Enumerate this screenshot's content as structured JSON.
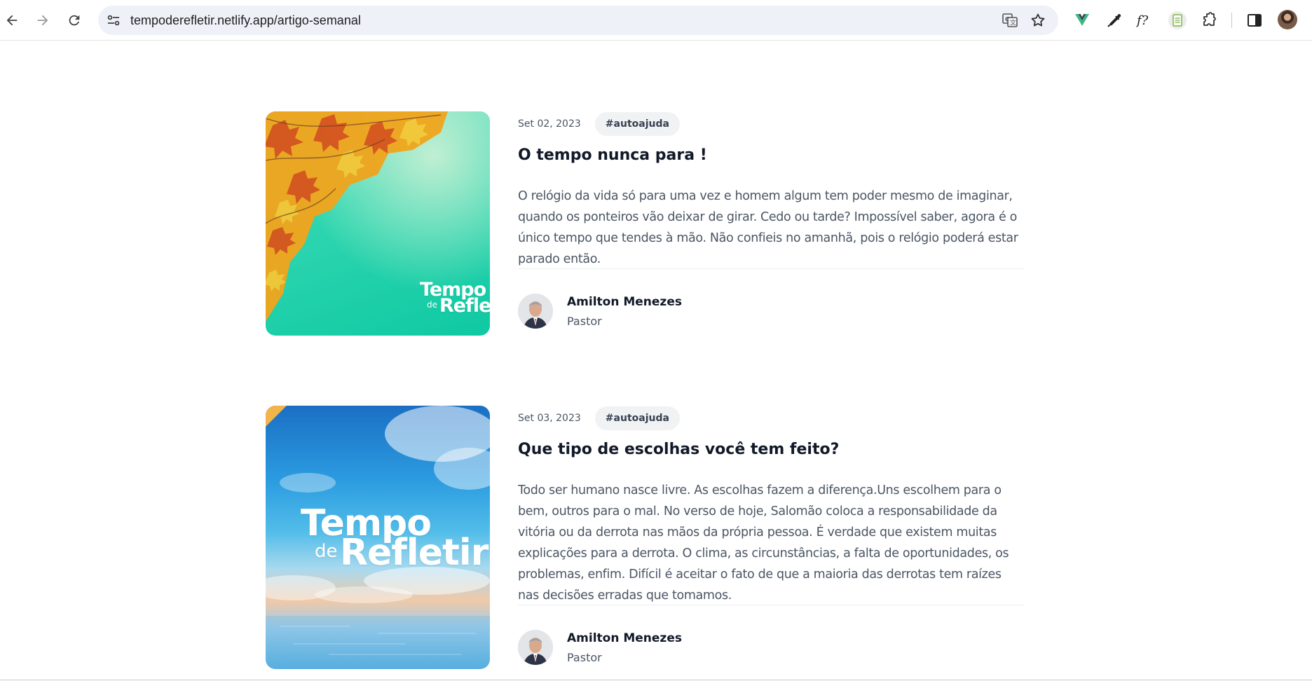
{
  "browser": {
    "url": "tempoderefletir.netlify.app/artigo-semanal"
  },
  "posts": [
    {
      "date": "Set 02, 2023",
      "tag": "#autoajuda",
      "title": "O tempo nunca para !",
      "excerpt": "O relógio da vida só para uma vez e homem algum tem poder mesmo de imaginar, quando os ponteiros vão deixar de girar. Cedo ou tarde? Impossível saber, agora é o único tempo que tendes à mão. Não confieis no amanhã, pois o relógio poderá estar parado então.",
      "thumbnail": {
        "brand_top": "Tempo",
        "brand_de": "de",
        "brand_bottom": "Refleti"
      },
      "author": {
        "name": "Amilton Menezes",
        "role": "Pastor"
      }
    },
    {
      "date": "Set 03, 2023",
      "tag": "#autoajuda",
      "title": "Que tipo de escolhas você tem feito?",
      "excerpt": "Todo ser humano nasce livre. As escolhas fazem a diferença.Uns escolhem para o bem, outros para o mal. No verso de hoje, Salomão coloca a responsabilidade da vitória ou da derrota nas mãos da própria pessoa. É verdade que existem muitas explicações para a derrota. O clima, as circunstâncias, a falta de oportunidades, os problemas, enfim. Difícil é aceitar o fato de que a maioria das derrotas tem raízes nas decisões erradas que tomamos.",
      "thumbnail": {
        "brand_top": "Tempo",
        "brand_de": "de",
        "brand_bottom": "Refletir"
      },
      "author": {
        "name": "Amilton Menezes",
        "role": "Pastor"
      }
    }
  ],
  "colors": {
    "omnibox_bg": "#eef1f8",
    "tag_bg": "#f1f2f4",
    "vue_green": "#41b883"
  },
  "icons": [
    "back-arrow-icon",
    "forward-arrow-icon",
    "reload-icon",
    "site-settings-icon",
    "translate-icon",
    "bookmark-star-icon",
    "vue-devtools-icon",
    "eyedropper-icon",
    "font-finder-icon",
    "sheet-extension-icon",
    "extensions-puzzle-icon",
    "side-panel-icon",
    "profile-avatar-icon"
  ]
}
